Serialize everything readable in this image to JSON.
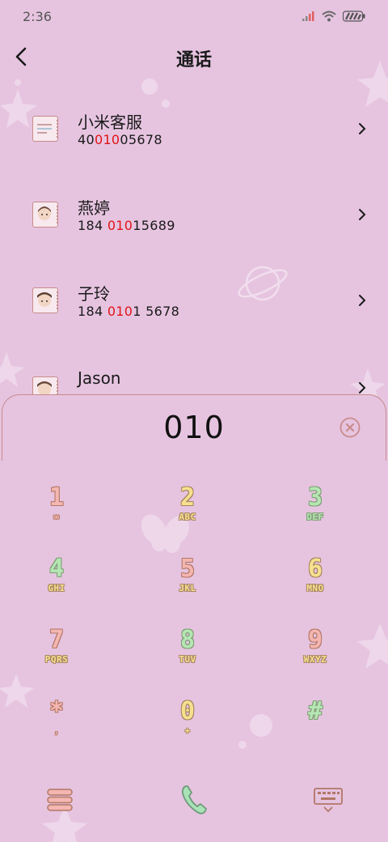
{
  "status_bar": {
    "time": "2:36",
    "icons": [
      "signal-icon",
      "wifi-icon",
      "battery-icon"
    ]
  },
  "header": {
    "title": "通话",
    "back_icon": "back-arrow-icon"
  },
  "contacts": [
    {
      "name": "小米客服",
      "number_pre": "40",
      "number_match": "010",
      "number_post": "05678"
    },
    {
      "name": "燕婷",
      "number_pre": "184 ",
      "number_match": "010",
      "number_post": "15689"
    },
    {
      "name": "子玲",
      "number_pre": "184 ",
      "number_match": "010",
      "number_post": "1 5678"
    },
    {
      "name": "Jason",
      "number_pre": "",
      "number_match": "",
      "number_post": ""
    }
  ],
  "dial": {
    "number": "010",
    "clear_icon": "clear-icon"
  },
  "keypad": [
    {
      "digit": "1",
      "letters": "∞"
    },
    {
      "digit": "2",
      "letters": "ABC"
    },
    {
      "digit": "3",
      "letters": "DEF"
    },
    {
      "digit": "4",
      "letters": "GHI"
    },
    {
      "digit": "5",
      "letters": "JKL"
    },
    {
      "digit": "6",
      "letters": "MNO"
    },
    {
      "digit": "7",
      "letters": "PQRS"
    },
    {
      "digit": "8",
      "letters": "TUV"
    },
    {
      "digit": "9",
      "letters": "WXYZ"
    },
    {
      "digit": "*",
      "letters": ","
    },
    {
      "digit": "0",
      "letters": "+"
    },
    {
      "digit": "#",
      "letters": ""
    }
  ],
  "bottom_bar": {
    "left_icon": "menu-icon",
    "center_icon": "call-icon",
    "right_icon": "keyboard-icon"
  },
  "colors": {
    "background": "#e6c4e0",
    "highlight": "#e01515",
    "accent_green": "#8fd9a8",
    "accent_pink": "#f4b6b0"
  }
}
